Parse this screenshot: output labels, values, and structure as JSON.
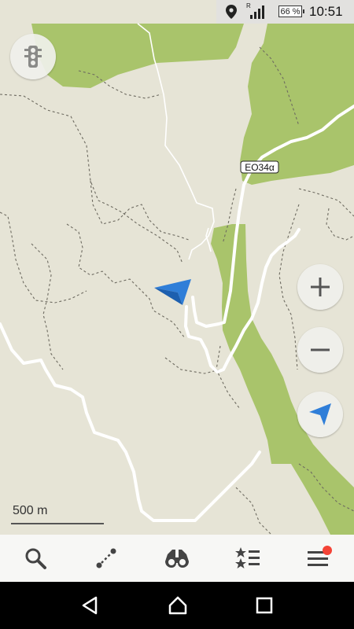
{
  "status_bar": {
    "time": "10:51",
    "battery": "66 %",
    "roaming_label": "R",
    "icons": [
      "location-icon",
      "signal-icon",
      "battery-icon"
    ]
  },
  "map": {
    "road_label": "EO34α",
    "scale_label": "500 m",
    "colors": {
      "land": "#e6e4d6",
      "forest": "#a9c46b",
      "road": "#ffffff",
      "position_arrow": "#2f7ed8"
    }
  },
  "controls": {
    "zoom_in_icon": "plus-icon",
    "zoom_out_icon": "minus-icon",
    "traffic_icon": "traffic-light-icon",
    "locate_icon": "navigation-arrow-icon"
  },
  "toolbar": {
    "items": [
      "search-icon",
      "route-icon",
      "binoculars-icon",
      "bookmarks-icon",
      "menu-icon"
    ],
    "menu_badge_color": "#f44336"
  },
  "nav_bar": {
    "items": [
      "back-icon",
      "home-icon",
      "recents-icon"
    ]
  }
}
